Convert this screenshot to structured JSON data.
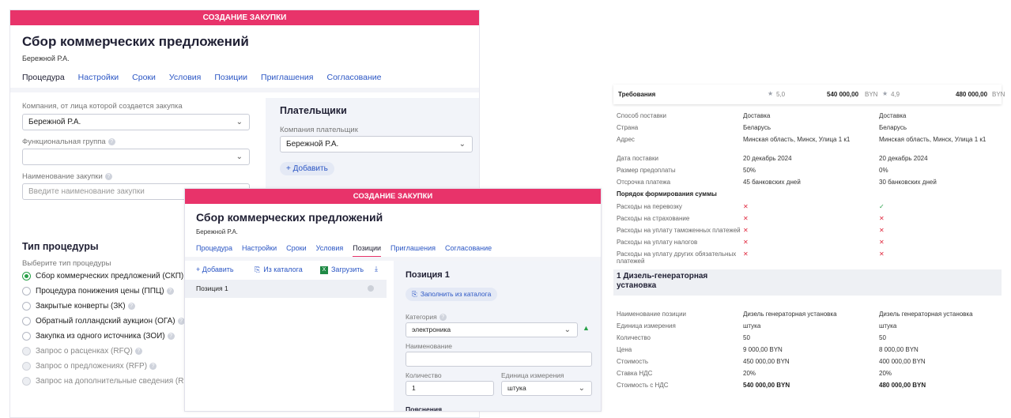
{
  "window1": {
    "banner": "СОЗДАНИЕ ЗАКУПКИ",
    "title": "Сбор коммерческих предложений",
    "subtitle": "Бережной Р.А.",
    "tabs": [
      "Процедура",
      "Настройки",
      "Сроки",
      "Условия",
      "Позиции",
      "Приглашения",
      "Согласование"
    ],
    "company_label": "Компания, от лица которой создается закупка",
    "company_value": "Бережной Р.А.",
    "group_label": "Функциональная группа",
    "group_value": "",
    "name_label": "Наименование закупки",
    "name_placeholder": "Введите наименование закупки",
    "payers": {
      "title": "Плательщики",
      "company_label": "Компания плательщик",
      "company_value": "Бережной Р.А.",
      "add_label": "+ Добавить"
    },
    "procedure": {
      "title": "Тип процедуры",
      "subtitle": "Выберите тип процедуры",
      "options": [
        "Сбор коммерческих предложений (СКП)",
        "Процедура понижения цены (ППЦ)",
        "Закрытые конверты (ЗК)",
        "Обратный голландский аукцион (ОГА)",
        "Закупка из одного источника (ЗОИ)",
        "Запрос о расценках (RFQ)",
        "Запрос о предложениях (RFP)",
        "Запрос на дополнительные сведения (RI"
      ],
      "selected_index": 0
    }
  },
  "window2": {
    "banner": "СОЗДАНИЕ ЗАКУПКИ",
    "title": "Сбор коммерческих предложений",
    "subtitle": "Бережной Р.А.",
    "tabs": [
      "Процедура",
      "Настройки",
      "Сроки",
      "Условия",
      "Позиции",
      "Приглашения",
      "Согласование"
    ],
    "active_tab_index": 4,
    "toolbar": {
      "add": "+ Добавить",
      "catalog": "Из каталога",
      "upload": "Загрузить"
    },
    "position_item": "Позиция 1",
    "detail": {
      "title": "Позиция 1",
      "fill_button": "Заполнить из каталога",
      "category_label": "Категория",
      "category_value": "электроника",
      "name_label": "Наименование",
      "name_value": "",
      "qty_label": "Количество",
      "qty_value": "1",
      "unit_label": "Единица измерения",
      "unit_value": "штука",
      "notes_label": "Пояснения"
    }
  },
  "comparison": {
    "header": {
      "label": "Требования",
      "s1_rating": "5,0",
      "s1_amount": "540 000,00",
      "s1_currency": "BYN",
      "s2_rating": "4,9",
      "s2_amount": "480 000,00",
      "s2_currency": "BYN"
    },
    "rows1": [
      {
        "label": "Способ поставки",
        "v1": "Доставка",
        "v2": "Доставка"
      },
      {
        "label": "Страна",
        "v1": "Беларусь",
        "v2": "Беларусь"
      },
      {
        "label": "Адрес",
        "v1": "Минская область, Минск, Улица 1 к1",
        "v2": "Минская область, Минск, Улица 1 к1"
      },
      {
        "label": "Дата поставки",
        "v1": "20 декабрь 2024",
        "v2": "20 декабрь 2024"
      },
      {
        "label": "Размер предоплаты",
        "v1": "50%",
        "v2": "0%"
      },
      {
        "label": "Отсрочка платежа",
        "v1": "45 банковских дней",
        "v2": "30 банковских дней"
      }
    ],
    "cost_heading": "Порядок формирования суммы",
    "cost_rows": [
      {
        "label": "Расходы на перевозку",
        "v1": "cross",
        "v2": "check"
      },
      {
        "label": "Расходы на страхование",
        "v1": "cross",
        "v2": "cross"
      },
      {
        "label": "Расходы на уплату таможенных платежей",
        "v1": "cross",
        "v2": "cross"
      },
      {
        "label": "Расходы на уплату налогов",
        "v1": "cross",
        "v2": "cross"
      },
      {
        "label": "Расходы на уплату других обязательных платежей",
        "v1": "cross",
        "v2": "cross"
      }
    ],
    "group_title": "1 Дизель-генераторная установка",
    "rows2": [
      {
        "label": "Наименование позиции",
        "v1": "Дизель генераторная установка",
        "v2": "Дизель генераторная установка",
        "bold": false
      },
      {
        "label": "Единица измерения",
        "v1": "штука",
        "v2": "штука",
        "bold": false
      },
      {
        "label": "Количество",
        "v1": "50",
        "v2": "50",
        "bold": false
      },
      {
        "label": "Цена",
        "v1": "9 000,00 BYN",
        "v2": "8 000,00 BYN",
        "bold": false
      },
      {
        "label": "Стоимость",
        "v1": "450 000,00 BYN",
        "v2": "400 000,00 BYN",
        "bold": false
      },
      {
        "label": "Ставка НДС",
        "v1": "20%",
        "v2": "20%",
        "bold": false
      },
      {
        "label": "Стоимость с НДС",
        "v1": "540 000,00 BYN",
        "v2": "480 000,00 BYN",
        "bold": true
      }
    ]
  }
}
